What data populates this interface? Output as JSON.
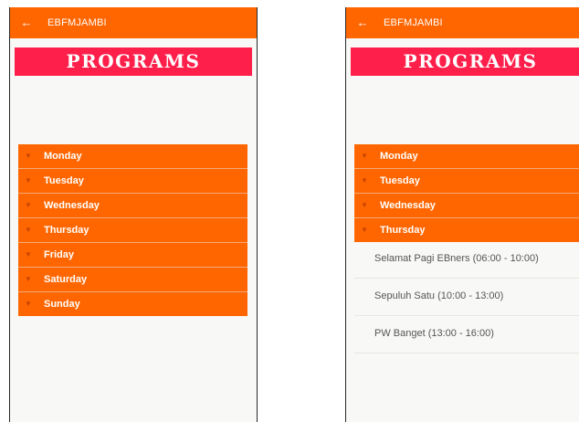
{
  "left_screen": {
    "app_title": "EBFMJAMBI",
    "back_icon": "←",
    "banner": "PROGRAMS",
    "days": [
      {
        "label": "Monday"
      },
      {
        "label": "Tuesday"
      },
      {
        "label": "Wednesday"
      },
      {
        "label": "Thursday"
      },
      {
        "label": "Friday"
      },
      {
        "label": "Saturday"
      },
      {
        "label": "Sunday"
      }
    ]
  },
  "right_screen": {
    "app_title": "EBFMJAMBI",
    "back_icon": "←",
    "banner": "PROGRAMS",
    "days": [
      {
        "label": "Monday"
      },
      {
        "label": "Tuesday"
      },
      {
        "label": "Wednesday"
      },
      {
        "label": "Thursday"
      }
    ],
    "expanded_day": "Thursday",
    "programs": [
      {
        "label": "Selamat Pagi EBners (06:00 - 10:00)"
      },
      {
        "label": "Sepuluh Satu (10:00 - 13:00)"
      },
      {
        "label": "PW Banget (13:00 - 16:00)"
      }
    ]
  },
  "icons": {
    "back": "arrow-left-icon",
    "expand": "chevron-down-icon"
  },
  "colors": {
    "appbar": "#ff6600",
    "banner": "#ff1f4b",
    "day_row": "#ff6600",
    "background": "#f8f8f6"
  }
}
